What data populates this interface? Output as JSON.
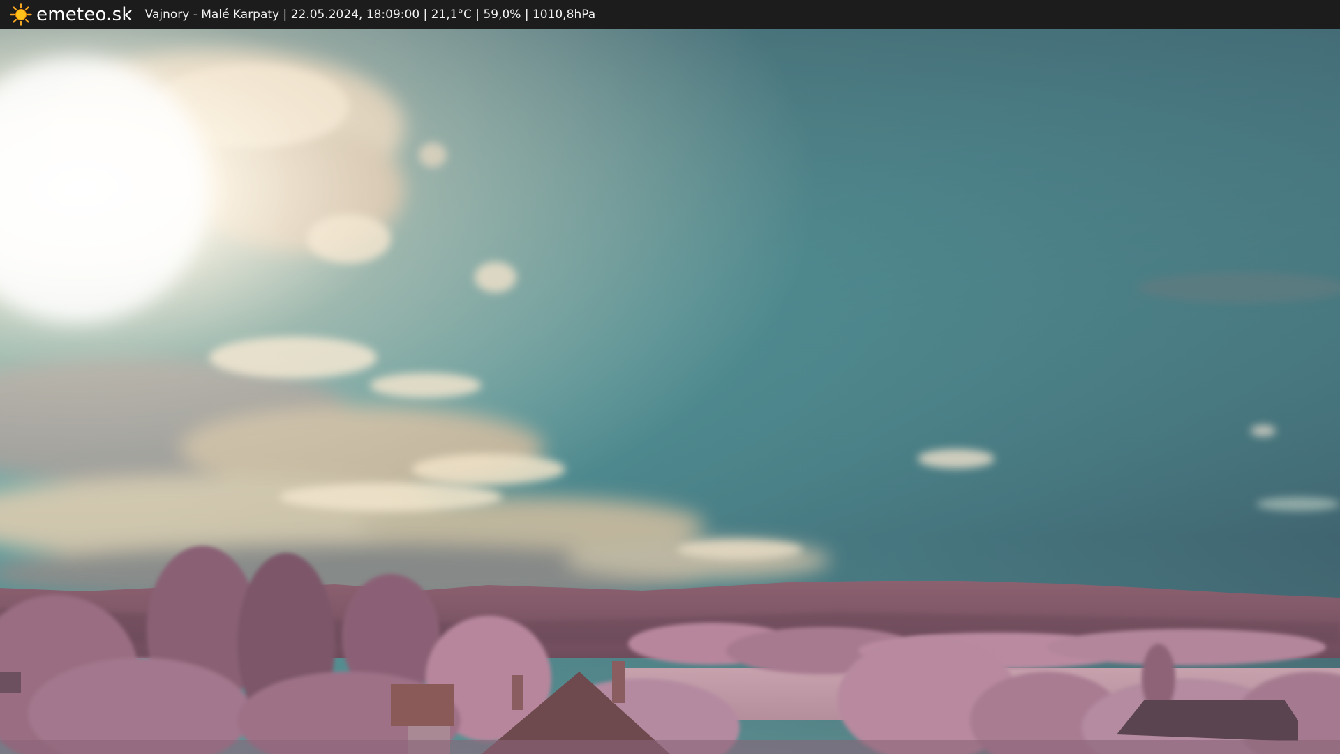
{
  "header": {
    "brand": "emeteo.sk",
    "caption": "Vajnory - Malé Karpaty | 22.05.2024, 18:09:00 | 21,1°C | 59,0% | 1010,8hPa",
    "logo_icon": "sun-icon"
  },
  "colors": {
    "header_bg": "#1c1c1c",
    "sky_top": "#3f5a66",
    "sky_mid": "#4e8e92",
    "sky_low": "#6aa8a2",
    "foliage": "#b9849c",
    "hills": "#8a5e6e",
    "sun_glow": "#fff6e6"
  }
}
